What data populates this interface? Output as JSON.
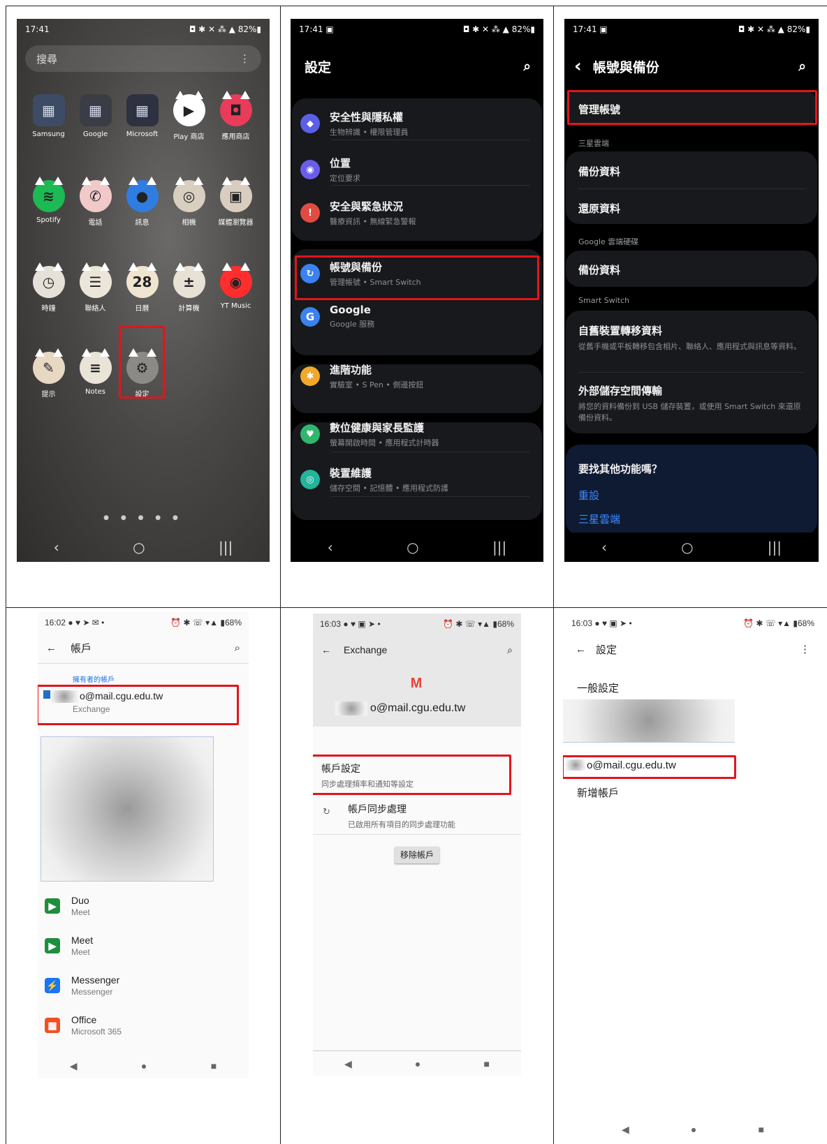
{
  "screen1": {
    "time": "17:41",
    "status_right": "◘ ✱ ✕ ⁂ ▲ 82%▮",
    "search_placeholder": "搜尋",
    "menu_glyph": "⋮",
    "apps": [
      {
        "label": "Samsung",
        "icon": "samsung-folder-icon",
        "glyph": "▦",
        "color": "#3e4b65"
      },
      {
        "label": "Google",
        "icon": "google-folder-icon",
        "glyph": "▦",
        "color": "#3a3d45"
      },
      {
        "label": "Microsoft",
        "icon": "microsoft-folder-icon",
        "glyph": "▦",
        "color": "#2e3140"
      },
      {
        "label": "Play 商店",
        "icon": "play-store-icon",
        "glyph": "▶",
        "color": "#ffffff"
      },
      {
        "label": "應用商店",
        "icon": "galaxy-store-icon",
        "glyph": "◘",
        "color": "#e83c5a"
      },
      {
        "label": "Spotify",
        "icon": "spotify-icon",
        "glyph": "≋",
        "color": "#1db954"
      },
      {
        "label": "電話",
        "icon": "phone-icon",
        "glyph": "✆",
        "color": "#f2c9c9"
      },
      {
        "label": "訊息",
        "icon": "messages-icon",
        "glyph": "●",
        "color": "#2f7de1"
      },
      {
        "label": "相機",
        "icon": "camera-icon",
        "glyph": "◎",
        "color": "#d9cfc1"
      },
      {
        "label": "媒體瀏覽器",
        "icon": "media-browser-icon",
        "glyph": "▣",
        "color": "#d8cdbf"
      },
      {
        "label": "時鐘",
        "icon": "clock-icon",
        "glyph": "◷",
        "color": "#e6e1d8"
      },
      {
        "label": "聯絡人",
        "icon": "contacts-icon",
        "glyph": "☰",
        "color": "#ece6da"
      },
      {
        "label": "日曆",
        "icon": "calendar-icon",
        "glyph": "28",
        "color": "#efe4cf"
      },
      {
        "label": "計算機",
        "icon": "calculator-icon",
        "glyph": "±",
        "color": "#e8e1d5"
      },
      {
        "label": "YT Music",
        "icon": "yt-music-icon",
        "glyph": "◉",
        "color": "#ff2d2d"
      },
      {
        "label": "提示",
        "icon": "tips-icon",
        "glyph": "✎",
        "color": "#e7d8c3"
      },
      {
        "label": "Notes",
        "icon": "notes-icon",
        "glyph": "≡",
        "color": "#e9e3d8"
      },
      {
        "label": "設定",
        "icon": "settings-icon",
        "glyph": "⚙",
        "color": "#8c8a86"
      }
    ],
    "page_dots": "● ● ● ● ●",
    "nav": {
      "back": "‹",
      "home": "○",
      "recent": "|||"
    }
  },
  "screen2": {
    "time": "17:41 ▣",
    "status_right": "◘ ✱ ✕ ⁂ ▲ 82%▮",
    "title": "設定",
    "search_glyph": "⌕",
    "items": [
      {
        "title": "安全性與隱私權",
        "sub": "生物辨識 • 權限管理員",
        "glyph": "◆",
        "color": "#5b5fe6"
      },
      {
        "title": "位置",
        "sub": "定位要求",
        "glyph": "◉",
        "color": "#6a5ee8"
      },
      {
        "title": "安全與緊急狀況",
        "sub": "醫療資訊 • 無線緊急警報",
        "glyph": "!",
        "color": "#e04b42"
      },
      {
        "title": "帳號與備份",
        "sub": "管理帳號 • Smart Switch",
        "glyph": "↻",
        "color": "#3b82f0"
      },
      {
        "title": "Google",
        "sub": "Google 服務",
        "glyph": "G",
        "color": "#3b82f0"
      },
      {
        "title": "進階功能",
        "sub": "實驗室 • S Pen • 側邊按鈕",
        "glyph": "✱",
        "color": "#f0a92b"
      },
      {
        "title": "數位健康與家長監護",
        "sub": "螢幕開啟時間 • 應用程式計時器",
        "glyph": "♥",
        "color": "#2fb86d"
      },
      {
        "title": "裝置維護",
        "sub": "儲存空間 • 記憶體 • 應用程式防護",
        "glyph": "◎",
        "color": "#24b39b"
      }
    ],
    "nav": {
      "back": "‹",
      "home": "○",
      "recent": "|||"
    }
  },
  "screen3": {
    "time": "17:41 ▣",
    "status_right": "◘ ✱ ✕ ⁂ ▲ 82%▮",
    "back_glyph": "‹",
    "title": "帳號與備份",
    "search_glyph": "⌕",
    "manage_accounts": "管理帳號",
    "section_samsung_cloud": "三星雲端",
    "backup_data": "備份資料",
    "restore_data": "還原資料",
    "section_google_drive": "Google 雲端硬碟",
    "google_backup_data": "備份資料",
    "section_smart_switch": "Smart Switch",
    "transfer_title": "自舊裝置轉移資料",
    "transfer_sub": "從舊手機或平板轉移包含相片、聯絡人、應用程式與訊息等資料。",
    "external_title": "外部儲存空間傳輸",
    "external_sub": "將您的資料備份到 USB 儲存裝置，或使用 Smart Switch 來還原備份資料。",
    "looking_title": "要找其他功能嗎？",
    "link_reset": "重設",
    "link_cloud": "三星雲端",
    "nav": {
      "back": "‹",
      "home": "○",
      "recent": "|||"
    }
  },
  "screen4": {
    "time": "16:02 ● ♥ ➤ ✉ •",
    "status_right": "⏰ ✱ ☏ ▾▲ ▮68%",
    "back_glyph": "←",
    "title": "帳戶",
    "search_glyph": "⌕",
    "section_owner": "擁有者的帳戶",
    "account_email": "o@mail.cgu.edu.tw",
    "account_type": "Exchange",
    "apps": [
      {
        "title": "Duo",
        "sub": "Meet",
        "glyph": "▶",
        "color": "#1e8e3e"
      },
      {
        "title": "Meet",
        "sub": "Meet",
        "glyph": "▶",
        "color": "#1e8e3e"
      },
      {
        "title": "Messenger",
        "sub": "Messenger",
        "glyph": "⚡",
        "color": "#1877f2"
      },
      {
        "title": "Office",
        "sub": "Microsoft 365",
        "glyph": "▦",
        "color": "#f25022"
      }
    ],
    "nav": {
      "back": "◀",
      "home": "●",
      "recent": "■"
    }
  },
  "screen5": {
    "time": "16:03 ● ♥ ▣ ➤ •",
    "status_right": "⏰ ✱ ☏ ▾▲ ▮68%",
    "back_glyph": "←",
    "title": "Exchange",
    "search_glyph": "⌕",
    "logo_glyph": "M",
    "account_email": "o@mail.cgu.edu.tw",
    "settings_title": "帳戶設定",
    "settings_sub": "同步處理頻率和通知等設定",
    "sync_glyph": "↻",
    "sync_title": "帳戶同步處理",
    "sync_sub": "已啟用所有項目的同步處理功能",
    "remove_button": "移除帳戶",
    "nav": {
      "back": "◀",
      "home": "●",
      "recent": "■"
    }
  },
  "screen6": {
    "time": "16:03 ● ♥ ▣ ➤ •",
    "status_right": "⏰ ✱ ☏ ▾▲ ▮68%",
    "back_glyph": "←",
    "title": "設定",
    "menu_glyph": "⋮",
    "general_settings": "一般設定",
    "account_email": "o@mail.cgu.edu.tw",
    "add_account": "新增帳戶",
    "nav": {
      "back": "◀",
      "home": "●",
      "recent": "■"
    }
  }
}
